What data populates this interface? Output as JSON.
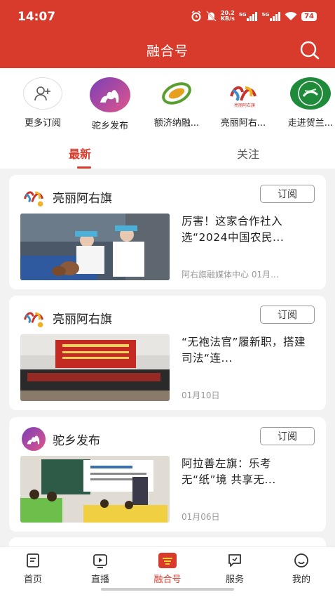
{
  "status": {
    "time": "14:07",
    "net_speed_top": "20.2",
    "net_speed_bottom": "KB/s",
    "sig1": "5G",
    "sig2": "5G",
    "battery": "74"
  },
  "header": {
    "title": "融合号"
  },
  "subscriptions": [
    {
      "label": "更多订阅",
      "icon": "add-user-icon"
    },
    {
      "label": "驼乡发布",
      "icon": "camel-logo-icon"
    },
    {
      "label": "额济纳融...",
      "icon": "green-leaf-logo-icon"
    },
    {
      "label": "亮丽阿右...",
      "icon": "colorful-logo-icon"
    },
    {
      "label": "走进贺兰...",
      "icon": "green-circle-logo-icon"
    }
  ],
  "tabs": {
    "latest": "最新",
    "follow": "关注"
  },
  "cards": [
    {
      "channel": "亮丽阿右旗",
      "subscribe": "订阅",
      "title": "厉害！这家合作社入选“2024中国农民...",
      "meta": "阿右旗融媒体中心 01月...",
      "image": "workers-food-processing"
    },
    {
      "channel": "亮丽阿右旗",
      "subscribe": "订阅",
      "title": "“无袍法官”履新职，搭建司法“连...",
      "meta": "01月10日",
      "image": "group-photo-stage"
    },
    {
      "channel": "驼乡发布",
      "subscribe": "订阅",
      "title": "阿拉善左旗：乐考无“纸”境 共享无...",
      "meta": "01月06日",
      "image": "classroom-kids"
    }
  ],
  "bottom_nav": [
    {
      "label": "首页",
      "icon": "home-doc-icon"
    },
    {
      "label": "直播",
      "icon": "play-tv-icon"
    },
    {
      "label": "融合号",
      "icon": "fusion-badge-icon"
    },
    {
      "label": "服务",
      "icon": "service-flag-icon"
    },
    {
      "label": "我的",
      "icon": "smile-user-icon"
    }
  ],
  "colors": {
    "brand": "#d83a2b"
  }
}
